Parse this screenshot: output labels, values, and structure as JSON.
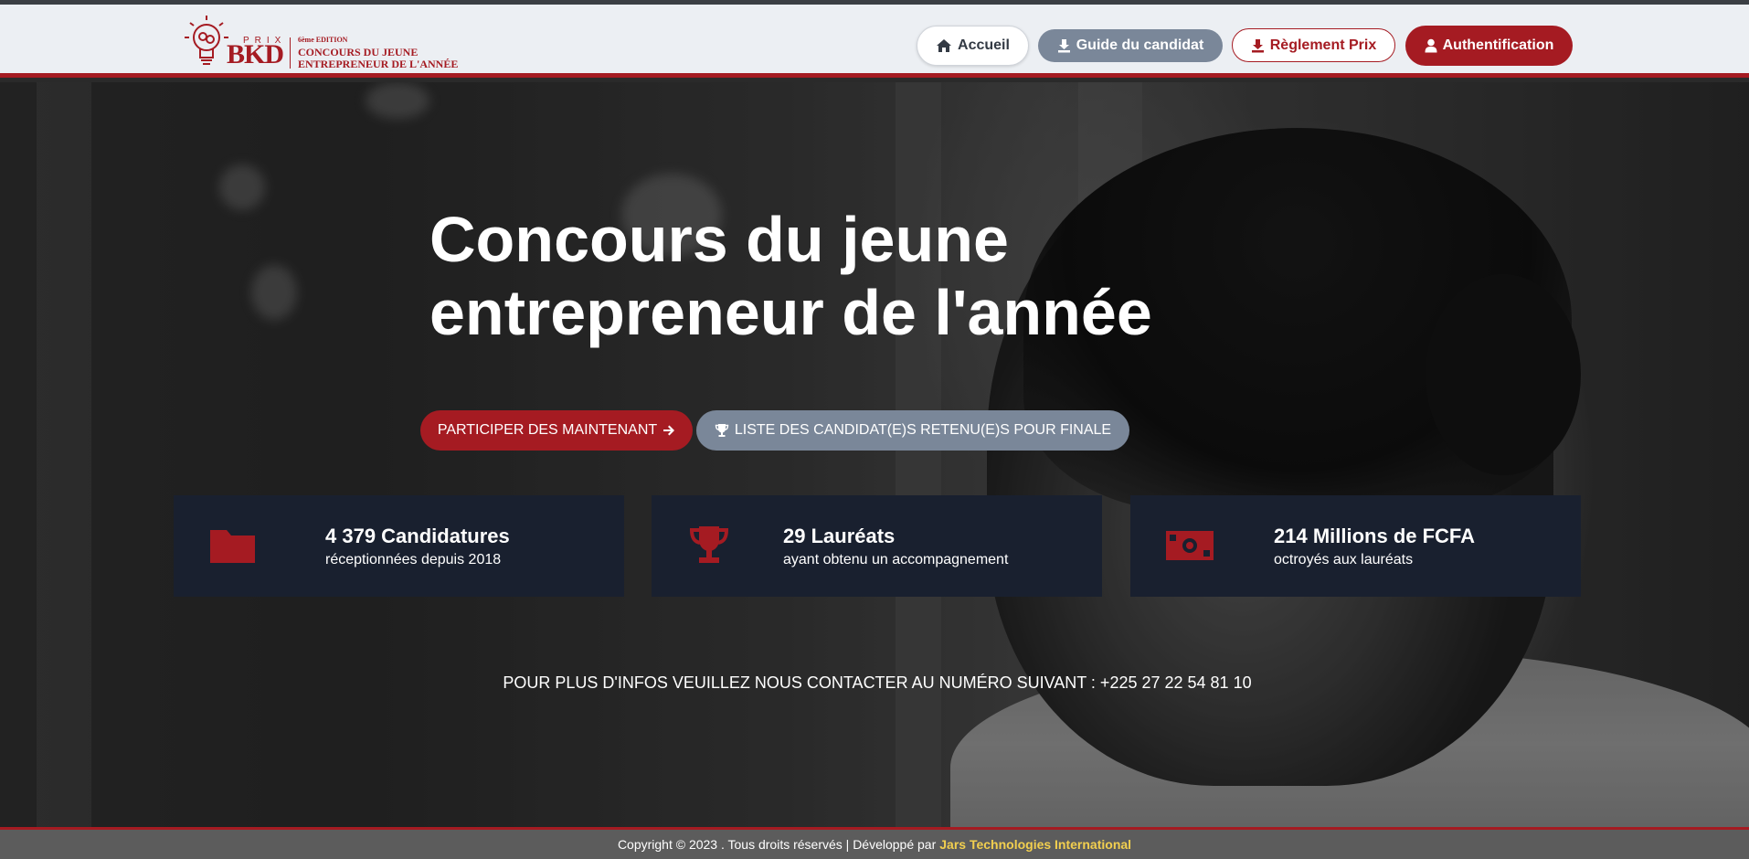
{
  "header": {
    "logo": {
      "prix": "PRIX",
      "brand": "BKD",
      "edition": "6ème EDITION",
      "line1": "CONCOURS DU JEUNE",
      "line2": "ENTREPRENEUR DE L'ANNÉE"
    },
    "nav": [
      {
        "label": "Accueil",
        "icon": "home-icon"
      },
      {
        "label": "Guide du candidat",
        "icon": "download-icon"
      },
      {
        "label": "Règlement Prix",
        "icon": "download-icon"
      },
      {
        "label": "Authentification",
        "icon": "user-icon"
      }
    ]
  },
  "hero": {
    "title_line1": "Concours du jeune",
    "title_line2": "entrepreneur de l'année",
    "cta_participer": "PARTICIPER DES MAINTENANT",
    "cta_liste": "LISTE DES CANDIDAT(E)S RETENU(E)S POUR FINALE",
    "stats": [
      {
        "title": "4 379 Candidatures",
        "subtitle": "réceptionnées depuis 2018",
        "icon": "folder-icon"
      },
      {
        "title": "29 Lauréats",
        "subtitle": "ayant obtenu un accompagnement",
        "icon": "trophy-icon"
      },
      {
        "title": "214 Millions de FCFA",
        "subtitle": "octroyés aux lauréats",
        "icon": "money-bill-icon"
      }
    ],
    "contact": "POUR PLUS D'INFOS VEUILLEZ NOUS CONTACTER AU NUMÉRO SUIVANT : +225 27 22 54 81 10"
  },
  "footer": {
    "text": "Copyright © 2023 . Tous droits réservés | Développé par",
    "link": "Jars Technologies International"
  },
  "colors": {
    "brand_red": "#a51b22",
    "slate": "#7a8799",
    "card_bg": "#19202f",
    "footer_link": "#f2cf4f"
  }
}
